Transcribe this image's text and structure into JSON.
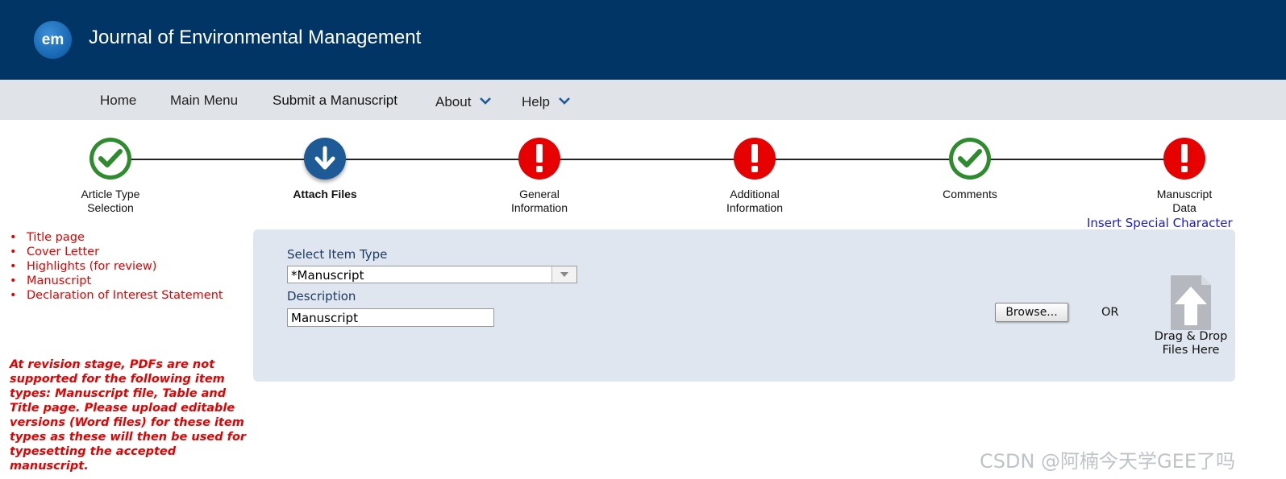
{
  "header": {
    "logo_text": "em",
    "title": "Journal of Environmental Management",
    "bg_color": "#003565"
  },
  "nav": {
    "items": [
      {
        "label": "Home"
      },
      {
        "label": "Main Menu"
      },
      {
        "label": "Submit a Manuscript"
      },
      {
        "label": "About",
        "icon": "chevron-down-icon"
      },
      {
        "label": "Help",
        "icon": "chevron-down-icon"
      }
    ]
  },
  "steps": [
    {
      "line1": "Article Type",
      "line2": "Selection",
      "status": "complete"
    },
    {
      "line1": "Attach Files",
      "line2": "",
      "status": "current"
    },
    {
      "line1": "General",
      "line2": "Information",
      "status": "error"
    },
    {
      "line1": "Additional",
      "line2": "Information",
      "status": "error"
    },
    {
      "line1": "Comments",
      "line2": "",
      "status": "complete"
    },
    {
      "line1": "Manuscript",
      "line2": "Data",
      "status": "error"
    }
  ],
  "insert_special_character": "Insert Special Character",
  "required_items": [
    "Title page",
    "Cover Letter",
    "Highlights (for review)",
    "Manuscript",
    "Declaration of Interest Statement"
  ],
  "pdf_note": "At revision stage, PDFs are not supported for the following item types: Manuscript file, Table and Title page. Please upload editable versions (Word files) for these item types as these will then be used for typesetting the accepted manuscript.",
  "upload": {
    "item_type_label": "Select Item Type",
    "item_type_value": "*Manuscript",
    "description_label": "Description",
    "description_value": "Manuscript",
    "browse_label": "Browse...",
    "or_label": "OR",
    "dnd_line1": "Drag & Drop",
    "dnd_line2": "Files Here"
  },
  "watermark": "CSDN @阿楠今天学GEE了吗",
  "colors": {
    "complete": "#2e8b2e",
    "current": "#1e5a96",
    "error": "#e60000",
    "link": "#1a1acc",
    "warning_text": "#e60000"
  }
}
